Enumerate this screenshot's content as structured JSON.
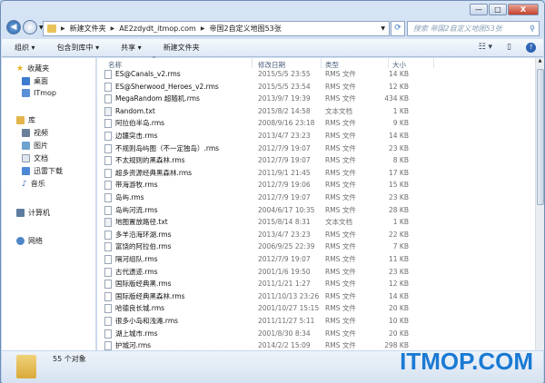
{
  "window": {
    "minimize": "—",
    "maximize": "□",
    "close": "X"
  },
  "address": {
    "crumbs": [
      "新建文件夹",
      "AE2zdydt_itmop.com",
      "帝国2自定义地图53张"
    ]
  },
  "search": {
    "placeholder": "搜索 帝国2自定义地图53张"
  },
  "toolbar": {
    "organize": "组织 ▾",
    "include": "包含到库中 ▾",
    "share": "共享 ▾",
    "new_folder": "新建文件夹"
  },
  "sidebar": {
    "items": [
      "收藏夹",
      "桌面",
      "ITmop",
      "库",
      "视频",
      "图片",
      "文档",
      "迅雷下载",
      "音乐",
      "计算机",
      "网络"
    ]
  },
  "columns": {
    "name": "名称",
    "date": "修改日期",
    "type": "类型",
    "size": "大小"
  },
  "files": [
    {
      "name": "ES@Canals_v2.rms",
      "date": "2015/5/5 23:55",
      "type": "RMS 文件",
      "size": "14 KB"
    },
    {
      "name": "ES@Sherwood_Heroes_v2.rms",
      "date": "2015/5/5 23:54",
      "type": "RMS 文件",
      "size": "12 KB"
    },
    {
      "name": "MegaRandom 超随机.rms",
      "date": "2013/9/7 19:39",
      "type": "RMS 文件",
      "size": "434 KB"
    },
    {
      "name": "Random.txt",
      "date": "2015/8/2 14:58",
      "type": "文本文档",
      "size": "1 KB"
    },
    {
      "name": "阿拉伯半岛.rms",
      "date": "2008/9/16 23:18",
      "type": "RMS 文件",
      "size": "9 KB"
    },
    {
      "name": "边疆突击.rms",
      "date": "2013/4/7 23:23",
      "type": "RMS 文件",
      "size": "14 KB"
    },
    {
      "name": "不规则岛屿图（不一定独岛）.rms",
      "date": "2012/7/9 19:07",
      "type": "RMS 文件",
      "size": "23 KB"
    },
    {
      "name": "不太规则的黑森林.rms",
      "date": "2012/7/9 19:07",
      "type": "RMS 文件",
      "size": "8 KB"
    },
    {
      "name": "超多资源经典黑森林.rms",
      "date": "2011/9/1 21:45",
      "type": "RMS 文件",
      "size": "17 KB"
    },
    {
      "name": "带海游牧.rms",
      "date": "2012/7/9 19:06",
      "type": "RMS 文件",
      "size": "15 KB"
    },
    {
      "name": "岛屿.rms",
      "date": "2012/7/9 19:07",
      "type": "RMS 文件",
      "size": "23 KB"
    },
    {
      "name": "岛屿河流.rms",
      "date": "2004/6/17 10:35",
      "type": "RMS 文件",
      "size": "28 KB"
    },
    {
      "name": "地图置放路径.txt",
      "date": "2015/8/14 8:31",
      "type": "文本文档",
      "size": "1 KB"
    },
    {
      "name": "多羊沿海环湖.rms",
      "date": "2013/4/7 23:23",
      "type": "RMS 文件",
      "size": "22 KB"
    },
    {
      "name": "富饶的阿拉伯.rms",
      "date": "2006/9/25 22:39",
      "type": "RMS 文件",
      "size": "7 KB"
    },
    {
      "name": "隔河组队.rms",
      "date": "2012/7/9 19:07",
      "type": "RMS 文件",
      "size": "11 KB"
    },
    {
      "name": "古代遗迹.rms",
      "date": "2001/1/6 19:50",
      "type": "RMS 文件",
      "size": "23 KB"
    },
    {
      "name": "国际版经典黑.rms",
      "date": "2011/1/21 1:27",
      "type": "RMS 文件",
      "size": "12 KB"
    },
    {
      "name": "国际版经典黑森林.rms",
      "date": "2011/10/13 23:26",
      "type": "RMS 文件",
      "size": "14 KB"
    },
    {
      "name": "哈德良长城.rms",
      "date": "2001/10/27 15:15",
      "type": "RMS 文件",
      "size": "20 KB"
    },
    {
      "name": "很多小岛和浅滩.rms",
      "date": "2011/11/27 5:11",
      "type": "RMS 文件",
      "size": "10 KB"
    },
    {
      "name": "湖上城市.rms",
      "date": "2001/8/30 8:34",
      "type": "RMS 文件",
      "size": "20 KB"
    },
    {
      "name": "护城河.rms",
      "date": "2014/2/2 15:09",
      "type": "RMS 文件",
      "size": "298 KB"
    }
  ],
  "status": {
    "count": "55 个对象"
  },
  "watermark": "ITMOP.COM"
}
